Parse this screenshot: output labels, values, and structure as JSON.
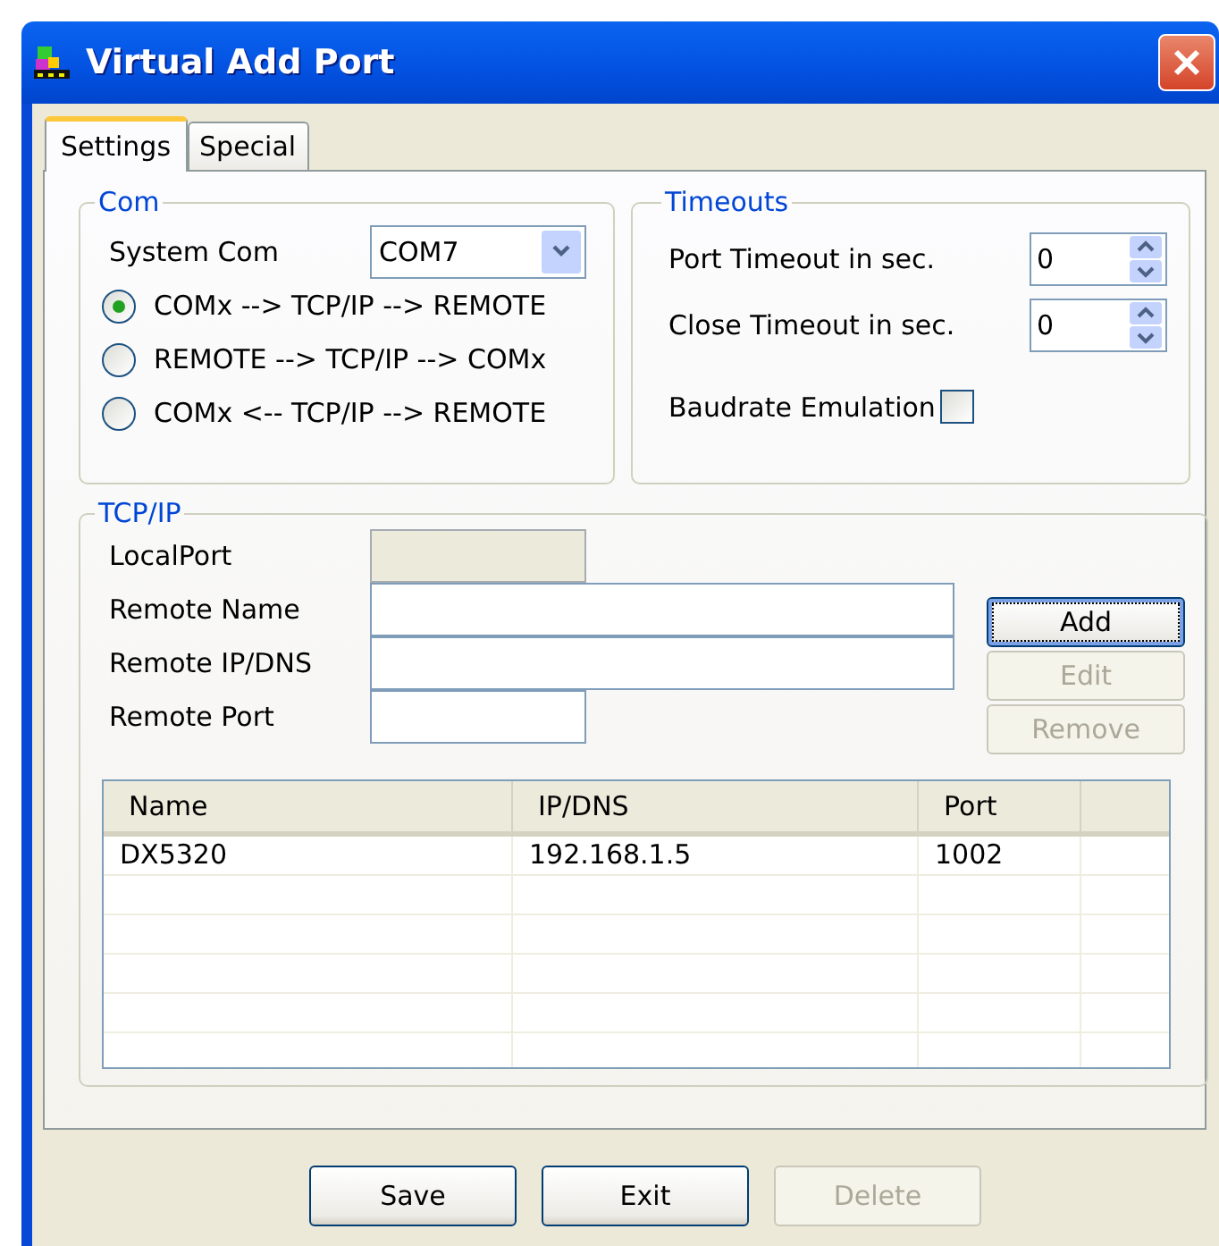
{
  "window": {
    "title": "Virtual Add Port"
  },
  "tabs": [
    {
      "label": "Settings",
      "selected": true
    },
    {
      "label": "Special",
      "selected": false
    }
  ],
  "com": {
    "title": "Com",
    "system_com_label": "System Com",
    "system_com_value": "COM7",
    "modes": [
      {
        "label": "COMx --> TCP/IP --> REMOTE",
        "selected": true
      },
      {
        "label": "REMOTE --> TCP/IP --> COMx",
        "selected": false
      },
      {
        "label": "COMx <-- TCP/IP --> REMOTE",
        "selected": false
      }
    ]
  },
  "timeouts": {
    "title": "Timeouts",
    "fields": [
      {
        "label": "Port Timeout in sec.",
        "value": "0"
      },
      {
        "label": "Close Timeout in sec.",
        "value": "0"
      }
    ],
    "baudrate_emulation": {
      "label": "Baudrate Emulation",
      "checked": false
    }
  },
  "tcpip": {
    "title": "TCP/IP",
    "fields": [
      {
        "label": "LocalPort",
        "kind": "short",
        "disabled": true
      },
      {
        "label": "Remote Name",
        "kind": "wide",
        "disabled": false
      },
      {
        "label": "Remote IP/DNS",
        "kind": "wide",
        "disabled": false
      },
      {
        "label": "Remote Port",
        "kind": "short",
        "disabled": false
      }
    ],
    "buttons": [
      {
        "label": "Add",
        "disabled": false,
        "focused": true
      },
      {
        "label": "Edit",
        "disabled": true,
        "focused": false
      },
      {
        "label": "Remove",
        "disabled": true,
        "focused": false
      }
    ],
    "table": {
      "columns": [
        "Name",
        "IP/DNS",
        "Port"
      ],
      "rows": [
        [
          "DX5320",
          "192.168.1.5",
          "1002"
        ]
      ]
    }
  },
  "buttons": [
    {
      "label": "Save",
      "disabled": false
    },
    {
      "label": "Exit",
      "disabled": false
    },
    {
      "label": "Delete",
      "disabled": true
    }
  ]
}
